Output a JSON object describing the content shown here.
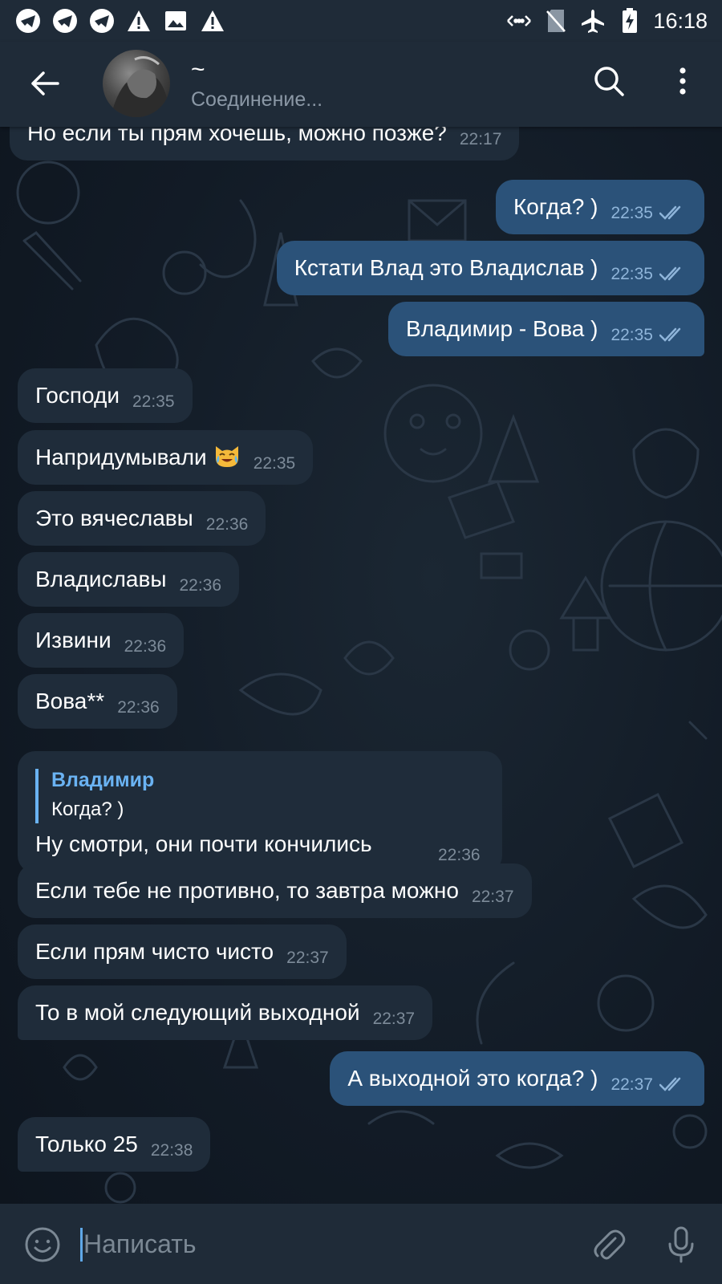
{
  "status_bar": {
    "time": "16:18",
    "left_icons": [
      "telegram-notification-icon",
      "telegram-notification-icon",
      "telegram-notification-icon",
      "warning-icon",
      "image-icon",
      "warning-icon"
    ],
    "right_icons": [
      "data-transfer-icon",
      "no-sim-icon",
      "airplane-icon",
      "battery-charging-icon"
    ]
  },
  "header": {
    "title": "~",
    "status": "Соединение..."
  },
  "colors": {
    "incoming_bubble": "#1f2c3a",
    "outgoing_bubble": "#2b5279",
    "accent": "#6ab3f3",
    "header": "#1f2b38"
  },
  "messages": [
    {
      "dir": "in",
      "text": "Но если ты прям хочешь, можно позже?",
      "time": "22:17"
    },
    {
      "dir": "out",
      "text": "Когда? )",
      "time": "22:35",
      "read": true
    },
    {
      "dir": "out",
      "text": "Кстати Влад это Владислав )",
      "time": "22:35",
      "read": true
    },
    {
      "dir": "out",
      "text": "Владимир - Вова )",
      "time": "22:35",
      "read": true
    },
    {
      "dir": "in",
      "text": "Господи",
      "time": "22:35"
    },
    {
      "dir": "in",
      "text": "Напридумывали",
      "emoji": "cat-tears-of-joy-emoji",
      "time": "22:35"
    },
    {
      "dir": "in",
      "text": "Это вячеславы",
      "time": "22:36"
    },
    {
      "dir": "in",
      "text": "Владиславы",
      "time": "22:36"
    },
    {
      "dir": "in",
      "text": "Извини",
      "time": "22:36"
    },
    {
      "dir": "in",
      "text": "Вова**",
      "time": "22:36"
    },
    {
      "dir": "in",
      "reply_author": "Владимир",
      "reply_text": "Когда? )",
      "text": "Ну смотри, они почти кончились",
      "time": "22:36"
    },
    {
      "dir": "in",
      "text": "Если тебе не противно, то завтра можно",
      "time": "22:37"
    },
    {
      "dir": "in",
      "text": "Если прям чисто чисто",
      "time": "22:37"
    },
    {
      "dir": "in",
      "text": "То в мой следующий выходной",
      "time": "22:37"
    },
    {
      "dir": "out",
      "text": "А выходной это когда? )",
      "time": "22:37",
      "read": true
    },
    {
      "dir": "in",
      "text": "Только 25",
      "time": "22:38"
    }
  ],
  "input": {
    "placeholder": "Написать",
    "value": ""
  }
}
